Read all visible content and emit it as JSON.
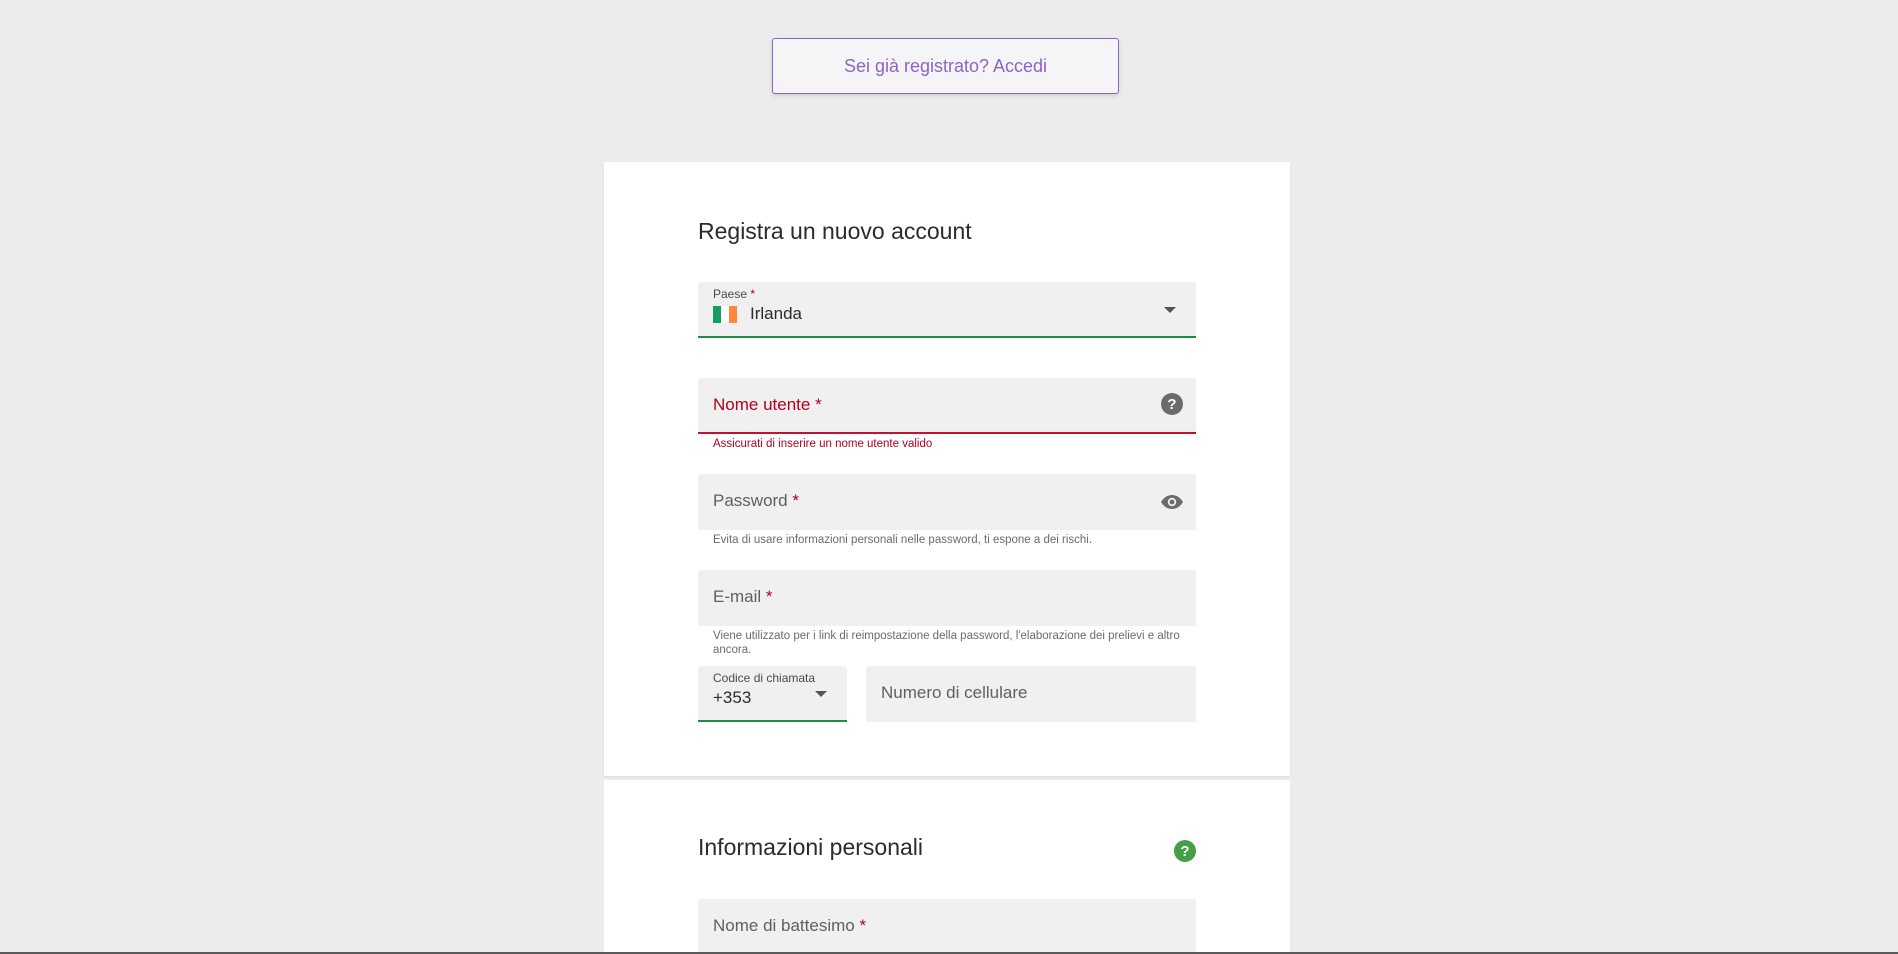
{
  "header": {
    "login_label": "Sei già registrato? Accedi"
  },
  "registration": {
    "title": "Registra un nuovo account",
    "country": {
      "label": "Paese",
      "required_mark": "*",
      "value": "Irlanda",
      "flag_colors": [
        "#169b62",
        "#ffffff",
        "#ff883e"
      ]
    },
    "username": {
      "label": "Nome utente",
      "required_mark": "*",
      "error": "Assicurati di inserire un nome utente valido"
    },
    "password": {
      "label": "Password",
      "required_mark": "*",
      "helper": "Evita di usare informazioni personali nelle password, ti espone a dei rischi."
    },
    "email": {
      "label": "E-mail",
      "required_mark": "*",
      "helper": "Viene utilizzato per i link di reimpostazione della password, l'elaborazione dei prelievi e altro ancora."
    },
    "calling_code": {
      "label": "Codice di chiamata",
      "value": "+353"
    },
    "mobile": {
      "placeholder": "Numero di cellulare"
    }
  },
  "personal_info": {
    "title": "Informazioni personali",
    "first_name": {
      "label": "Nome di battesimo",
      "required_mark": "*"
    }
  },
  "colors": {
    "accent_purple": "#8d63c5",
    "success_green": "#1e8e3e",
    "error_red": "#b00020",
    "help_green": "#43a047"
  }
}
